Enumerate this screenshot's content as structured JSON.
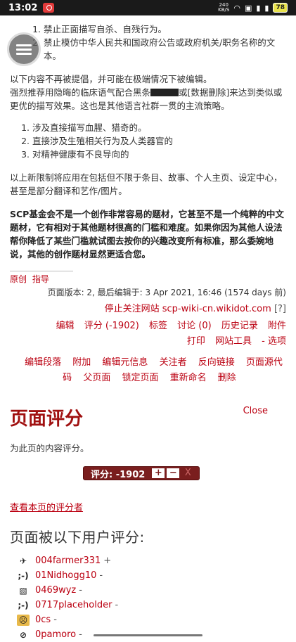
{
  "statusbar": {
    "time": "13:02",
    "net_speed_top": "240",
    "net_speed_bottom": "KB/S",
    "battery": "78"
  },
  "list1": [
    "禁止正面描写自杀、自残行为。",
    "禁止模仿中华人民共和国政府公告或政府机关/职务名称的文本。"
  ],
  "para1_line1": "以下内容不再被提倡，并可能在极端情况下被编辑。",
  "para1_line2_a": "强烈推荐用隐晦的临床语气配合黑条",
  "para1_line2_b": "或[数据删除]来达到类似或更优的描写效果。这也是其他语言社群一贯的主流策略。",
  "list2": [
    "涉及直接描写血腥、猎奇的。",
    "直接涉及生殖相关行为及人类器官的",
    "对精神健康有不良导向的"
  ],
  "para2": "以上新限制将应用在包括但不限于条目、故事、个人主页、设定中心，甚至是部分翻译和艺作/图片。",
  "para3": "SCP基金会不是一个创作非常容易的题材，它甚至不是一个纯粹的中文题材，它有相对于其他题材很高的门槛和难度。如果你因为其他人设法帮你降低了某些门槛就试图去按你的兴趣改变所有标准，那么委婉地说，其他的创作题材显然更适合您。",
  "footer": {
    "origin": "原创",
    "guide": "指导",
    "page_info": "页面版本: 2, 最后编辑于: 3 Apr 2021, 16:46 (1574 days 前)",
    "unwatch": "停止关注网站 scp-wiki-cn.wikidot.com",
    "help": "[?]"
  },
  "options_row1": [
    "编辑",
    "评分 (-1902)",
    "标签",
    "讨论 (0)",
    "历史记录",
    "附件",
    "打印",
    "网站工具",
    "- 选项"
  ],
  "options_row2": [
    "编辑段落",
    "附加",
    "编辑元信息",
    "关注者",
    "反向链接",
    "页面源代码",
    "父页面",
    "锁定页面",
    "重新命名",
    "删除"
  ],
  "rating": {
    "title": "页面评分",
    "close": "Close",
    "description": "为此页的内容评分。",
    "label": "评分: -1902",
    "plus": "+",
    "minus": "−",
    "cancel": "X",
    "raters_link": "查看本页的评分者",
    "raters_title": "页面被以下用户评分:"
  },
  "raters": [
    {
      "avatar": "plane",
      "name": "004farmer331",
      "vote": "+"
    },
    {
      "avatar": ";-)",
      "name": "01Nidhogg10",
      "vote": "-"
    },
    {
      "avatar": "sketch",
      "name": "0469wyz",
      "vote": "-"
    },
    {
      "avatar": ";-)",
      "name": "0717placeholder",
      "vote": "-"
    },
    {
      "avatar": "face",
      "name": "0cs",
      "vote": "-"
    },
    {
      "avatar": "no",
      "name": "0pamoro",
      "vote": "-"
    }
  ]
}
